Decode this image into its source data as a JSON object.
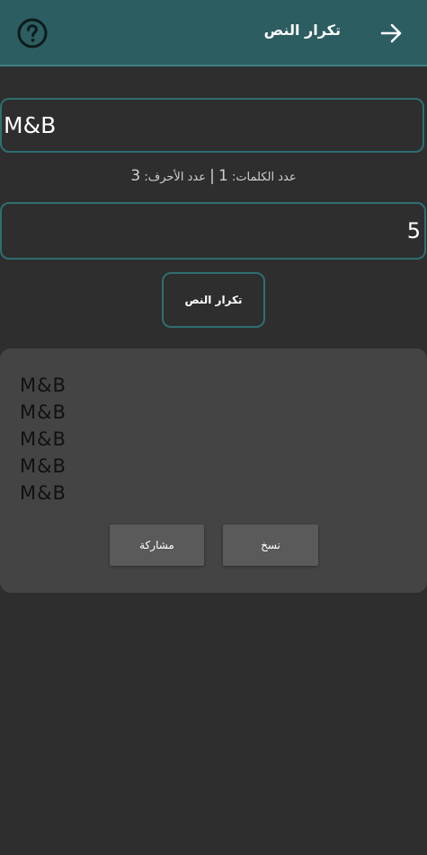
{
  "header": {
    "title": "تكرار النص",
    "background": "#2c5d61"
  },
  "input": {
    "value": "M&B"
  },
  "counter": {
    "words_label": "عدد الكلمات:",
    "words_value": "1",
    "separator": "|",
    "chars_label": "عدد الأحرف:",
    "chars_value": "3"
  },
  "repeat": {
    "value": "5"
  },
  "buttons": {
    "repeat_label": "تكرار النص",
    "share_label": "مشاركة",
    "copy_label": "نسخ"
  },
  "result": {
    "lines": [
      "M&B",
      "M&B",
      "M&B",
      "M&B",
      "M&B"
    ]
  },
  "icons": {
    "back": "arrow-right-icon",
    "help": "question-circle-icon"
  },
  "colors": {
    "accent_border": "#2f6e71",
    "background": "#2e2e2f",
    "card": "#444445"
  }
}
